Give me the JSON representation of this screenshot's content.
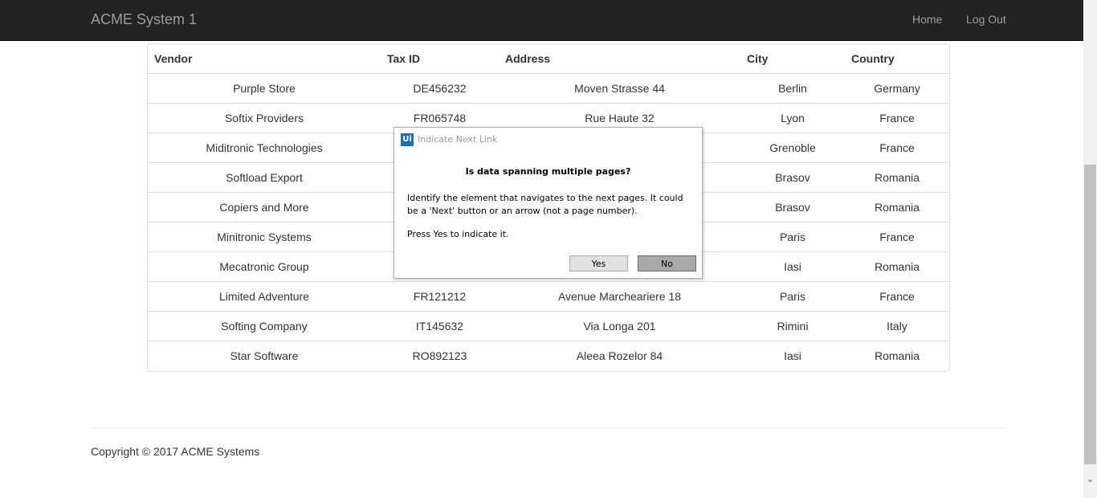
{
  "navbar": {
    "brand": "ACME System 1",
    "links": [
      "Home",
      "Log Out"
    ]
  },
  "table": {
    "headers": [
      "Vendor",
      "Tax ID",
      "Address",
      "City",
      "Country"
    ],
    "rows": [
      [
        "Purple Store",
        "DE456232",
        "Moven Strasse 44",
        "Berlin",
        "Germany"
      ],
      [
        "Softix Providers",
        "FR065748",
        "Rue Haute 32",
        "Lyon",
        "France"
      ],
      [
        "Miditronic Technologies",
        "",
        "",
        "Grenoble",
        "France"
      ],
      [
        "Softload Export",
        "",
        "",
        "Brasov",
        "Romania"
      ],
      [
        "Copiers and More",
        "",
        "",
        "Brasov",
        "Romania"
      ],
      [
        "Minitronic Systems",
        "",
        "",
        "Paris",
        "France"
      ],
      [
        "Mecatronic Group",
        "",
        "",
        "Iasi",
        "Romania"
      ],
      [
        "Limited Adventure",
        "FR121212",
        "Avenue Marcheariere 18",
        "Paris",
        "France"
      ],
      [
        "Softing Company",
        "IT145632",
        "Via Longa 201",
        "Rimini",
        "Italy"
      ],
      [
        "Star Software",
        "RO892123",
        "Aleea Rozelor 84",
        "Iasi",
        "Romania"
      ]
    ]
  },
  "footer": {
    "copyright": "Copyright © 2017 ACME Systems"
  },
  "dialog": {
    "icon_text": "Ui",
    "title": "Indicate Next Link",
    "heading": "Is data spanning multiple pages?",
    "body": "Identify the element that navigates to the next pages. It could be a 'Next' button or an arrow (not a page number).",
    "hint": "Press Yes to indicate it.",
    "yes_label": "Yes",
    "no_label": "No"
  },
  "colors": {
    "navbar_bg": "#222222",
    "nav_text": "#9d9d9d",
    "dialog_icon": "#1a6fb5"
  }
}
